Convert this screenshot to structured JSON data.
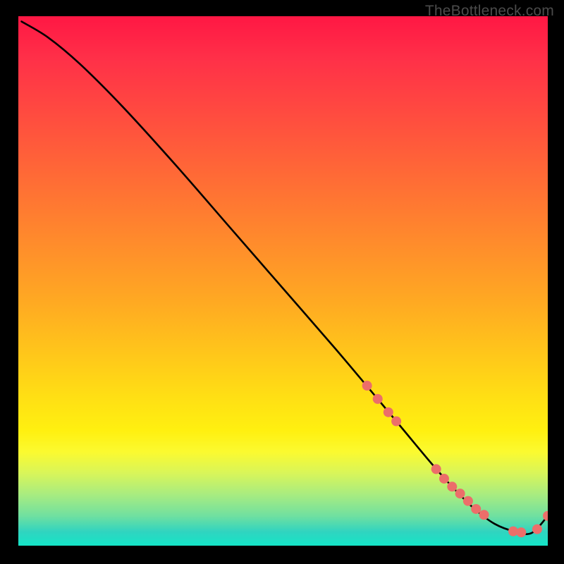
{
  "watermark": "TheBottleneck.com",
  "chart_data": {
    "type": "line",
    "title": "",
    "xlabel": "",
    "ylabel": "",
    "xlim": [
      0,
      100
    ],
    "ylim": [
      0,
      100
    ],
    "grid": false,
    "legend": false,
    "background": "rainbow-vertical-gradient-red-to-cyan",
    "series": [
      {
        "name": "curve",
        "type": "line",
        "color": "#000000",
        "x": [
          1,
          6,
          12,
          20,
          30,
          40,
          50,
          60,
          68,
          73,
          78,
          82,
          86,
          90,
          94,
          97,
          100
        ],
        "y": [
          99,
          96,
          91,
          83,
          72,
          60.5,
          49,
          37.5,
          28,
          22,
          16,
          11.5,
          7.5,
          4.5,
          3,
          2.8,
          6
        ]
      },
      {
        "name": "markers",
        "type": "scatter",
        "color": "#ec6e6a",
        "x": [
          66,
          68,
          70,
          71.5,
          79,
          80.5,
          82,
          83.5,
          85,
          86.5,
          88,
          93.5,
          95,
          98,
          100
        ],
        "y": [
          30.5,
          28,
          25.5,
          23.8,
          14.8,
          13,
          11.5,
          10.2,
          8.8,
          7.3,
          6.2,
          3.1,
          2.9,
          3.5,
          6
        ]
      }
    ]
  }
}
